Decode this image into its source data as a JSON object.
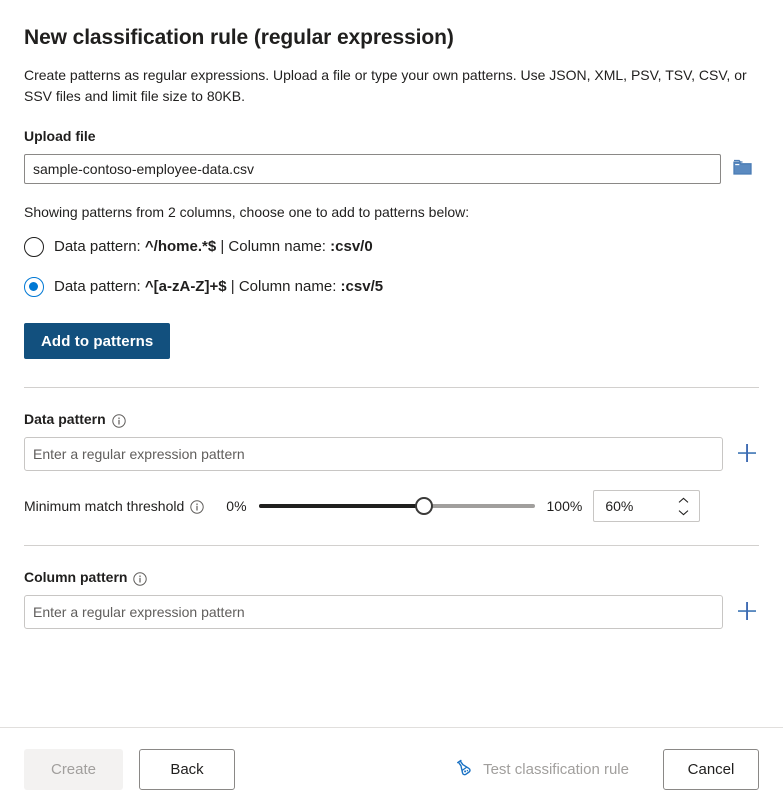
{
  "dialog": {
    "title": "New classification rule (regular expression)",
    "description": "Create patterns as regular expressions. Upload a file or type your own patterns. Use JSON, XML, PSV, TSV, CSV, or SSV files and limit file size to 80KB."
  },
  "upload": {
    "label": "Upload file",
    "value": "sample-contoso-employee-data.csv",
    "placeholder": "",
    "browse_icon": "folder-icon"
  },
  "patterns_preview": {
    "caption": "Showing patterns from 2 columns, choose one to add to patterns below:",
    "options": [
      {
        "data_prefix": "Data pattern: ",
        "data_value": "^/home.*$",
        "separator": "|",
        "column_prefix": "Column name: ",
        "column_value": ":csv/0",
        "selected": false
      },
      {
        "data_prefix": "Data pattern: ",
        "data_value": "^[a-zA-Z]+$",
        "separator": "|",
        "column_prefix": "Column name: ",
        "column_value": ":csv/5",
        "selected": true
      }
    ],
    "add_button": "Add to patterns"
  },
  "data_pattern": {
    "label": "Data pattern",
    "info_icon": "info-icon",
    "placeholder": "Enter a regular expression pattern",
    "value": "",
    "add_icon": "plus-icon"
  },
  "threshold": {
    "label": "Minimum match threshold",
    "info_icon": "info-icon",
    "min_label": "0%",
    "max_label": "100%",
    "value": "60%",
    "percent": 60,
    "increment_icon": "chevron-up-icon",
    "decrement_icon": "chevron-down-icon"
  },
  "column_pattern": {
    "label": "Column pattern",
    "info_icon": "info-icon",
    "placeholder": "Enter a regular expression pattern",
    "value": "",
    "add_icon": "plus-icon"
  },
  "footer": {
    "create": "Create",
    "back": "Back",
    "test": "Test classification rule",
    "test_icon": "beaker-icon",
    "cancel": "Cancel"
  },
  "colors": {
    "primary_button": "#12507e",
    "accent": "#0078d4",
    "icon_blue": "#4a7cb5",
    "disabled_text": "#a19f9d",
    "border": "#8a8886",
    "divider": "#d2d0ce"
  }
}
